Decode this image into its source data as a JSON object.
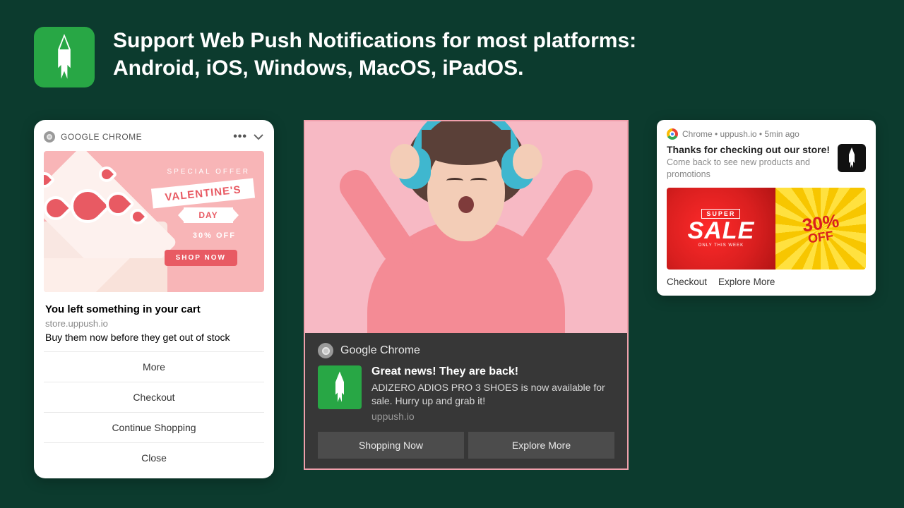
{
  "header": {
    "line1": "Support Web Push Notifications for most platforms:",
    "line2": "Android, iOS, Windows, MacOS, iPadOS."
  },
  "card1": {
    "browser": "GOOGLE CHROME",
    "banner": {
      "special": "SPECIAL OFFER",
      "strip1": "VALENTINE'S",
      "strip2": "DAY",
      "discount": "30% OFF",
      "shop": "SHOP NOW"
    },
    "title": "You left something in your cart",
    "site": "store.uppush.io",
    "body": "Buy them now before they get out of stock",
    "actions": [
      "More",
      "Checkout",
      "Continue Shopping",
      "Close"
    ]
  },
  "card2": {
    "browser": "Google Chrome",
    "title": "Great news! They are back!",
    "body": "ADIZERO ADIOS PRO 3 SHOES is now available for sale. Hurry up and grab it!",
    "site": "uppush.io",
    "actions": [
      "Shopping Now",
      "Explore More"
    ]
  },
  "card3": {
    "meta": "Chrome • uppush.io • 5min ago",
    "title": "Thanks for checking out our store!",
    "body": "Come back to see new products and promotions",
    "banner": {
      "super": "SUPER",
      "sale": "SALE",
      "only": "ONLY THIS WEEK",
      "pct": "30%",
      "off": "OFF"
    },
    "actions": [
      "Checkout",
      "Explore More"
    ]
  },
  "icons": {
    "rocket": "rocket-icon",
    "chrome": "chrome-icon",
    "dots": "more-options-icon",
    "chevron": "chevron-down-icon"
  }
}
